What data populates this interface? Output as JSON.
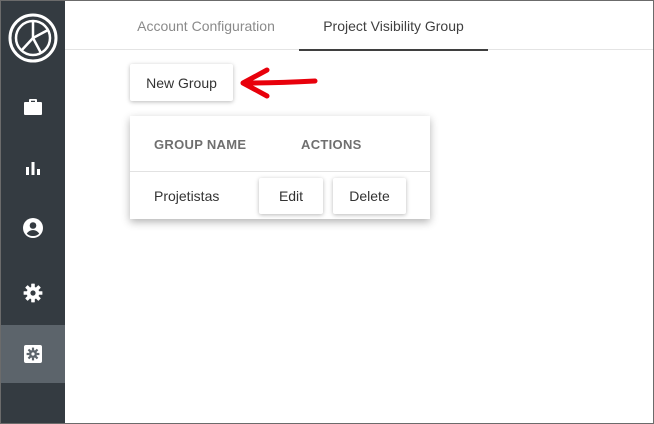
{
  "sidebar": {
    "items": [
      {
        "icon": "briefcase-icon",
        "active": false
      },
      {
        "icon": "bar-chart-icon",
        "active": false
      },
      {
        "icon": "account-circle-icon",
        "active": false
      },
      {
        "icon": "gear-icon",
        "active": false
      },
      {
        "icon": "settings-box-icon",
        "active": true
      }
    ]
  },
  "tabs": [
    {
      "label": "Account Configuration",
      "active": false
    },
    {
      "label": "Project Visibility Group",
      "active": true
    }
  ],
  "toolbar": {
    "new_group_label": "New Group"
  },
  "table": {
    "columns": [
      "GROUP NAME",
      "ACTIONS"
    ],
    "rows": [
      {
        "name": "Projetistas",
        "edit_label": "Edit",
        "delete_label": "Delete"
      }
    ]
  },
  "colors": {
    "sidebar_bg": "#343b41",
    "sidebar_active_bg": "#5c646b",
    "annotation_arrow": "#e8000b"
  }
}
